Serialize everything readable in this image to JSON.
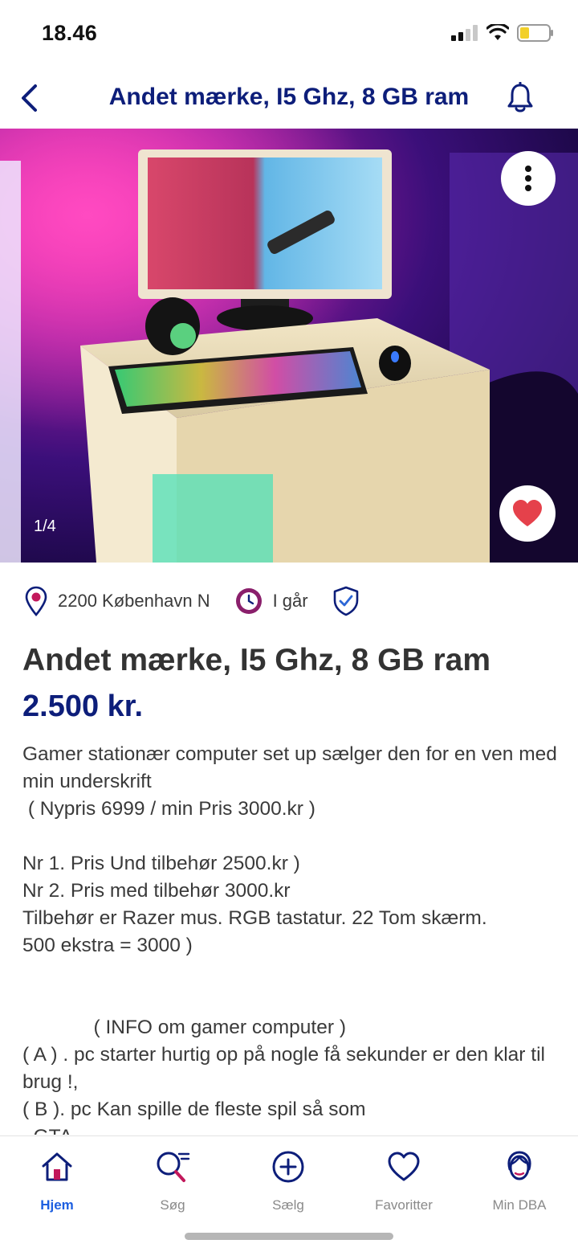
{
  "status_bar": {
    "time": "18.46"
  },
  "header": {
    "title": "Andet mærke, I5 Ghz, 8 GB ram"
  },
  "gallery": {
    "counter": "1/4"
  },
  "meta": {
    "location": "2200 København N",
    "posted": "I går"
  },
  "listing": {
    "title": "Andet mærke, I5 Ghz, 8 GB ram",
    "price": "2.500 kr.",
    "description": "Gamer stationær computer set up sælger den for en ven med min underskrift\n ( Nypris 6999 / min Pris 3000.kr )\n\nNr 1. Pris Und tilbehør 2500.kr )\nNr 2. Pris med tilbehør 3000.kr\nTilbehør er Razer mus. RGB tastatur. 22 Tom skærm.\n500 ekstra = 3000 )\n\n\n             ( INFO om gamer computer )\n( A ) . pc starter hurtig op på nogle få sekunder er den klar til brug !,\n( B ). pc Kan spille de fleste spil så som\n  GTA"
  },
  "bottom_nav": {
    "items": [
      {
        "label": "Hjem",
        "icon": "home-icon",
        "active": true
      },
      {
        "label": "Søg",
        "icon": "search-icon",
        "active": false
      },
      {
        "label": "Sælg",
        "icon": "plus-circle-icon",
        "active": false
      },
      {
        "label": "Favoritter",
        "icon": "heart-icon",
        "active": false
      },
      {
        "label": "Min DBA",
        "icon": "profile-icon",
        "active": false
      }
    ]
  },
  "colors": {
    "brand_navy": "#0d1e7a",
    "nav_active": "#1d5fe0",
    "favorite_red": "#e5414b",
    "icon_purple": "#8a1f6b"
  }
}
